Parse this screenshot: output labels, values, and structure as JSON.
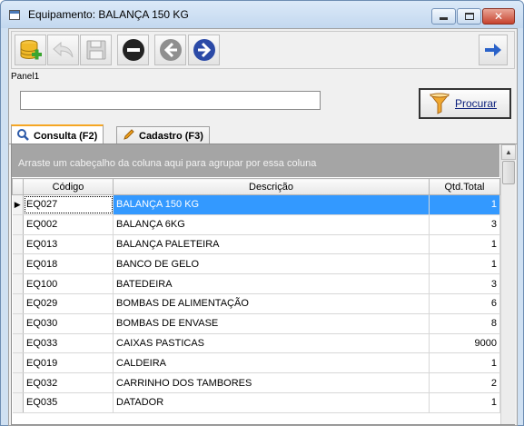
{
  "window": {
    "title": "Equipamento: BALANÇA 150 KG",
    "close_glyph": "✕"
  },
  "toolbar": {
    "buttons": [
      "database-add-icon",
      "undo-icon",
      "save-icon",
      "cancel-icon",
      "back-arrow-icon",
      "forward-arrow-icon"
    ],
    "right_button": "next-icon"
  },
  "panel": {
    "label": "Panel1",
    "search_value": "",
    "search_button_label": "Procurar"
  },
  "tabs": [
    {
      "label": "Consulta (F2)",
      "icon": "search-icon"
    },
    {
      "label": "Cadastro (F3)",
      "icon": "pencil-icon"
    }
  ],
  "grid": {
    "group_hint": "Arraste um cabeçalho da coluna aqui para agrupar por essa coluna",
    "columns": [
      "Código",
      "Descrição",
      "Qtd.Total"
    ],
    "rows": [
      [
        "EQ027",
        "BALANÇA 150 KG",
        "1"
      ],
      [
        "EQ002",
        "BALANÇA 6KG",
        "3"
      ],
      [
        "EQ013",
        "BALANÇA PALETEIRA",
        "1"
      ],
      [
        "EQ018",
        "BANCO DE GELO",
        "1"
      ],
      [
        "EQ100",
        "BATEDEIRA",
        "3"
      ],
      [
        "EQ029",
        "BOMBAS DE ALIMENTAÇÃO",
        "6"
      ],
      [
        "EQ030",
        "BOMBAS DE ENVASE",
        "8"
      ],
      [
        "EQ033",
        "CAIXAS PASTICAS",
        "9000"
      ],
      [
        "EQ019",
        "CALDEIRA",
        "1"
      ],
      [
        "EQ032",
        "CARRINHO DOS TAMBORES",
        "2"
      ],
      [
        "EQ035",
        "DATADOR",
        "1"
      ]
    ],
    "selected_row": 0
  }
}
